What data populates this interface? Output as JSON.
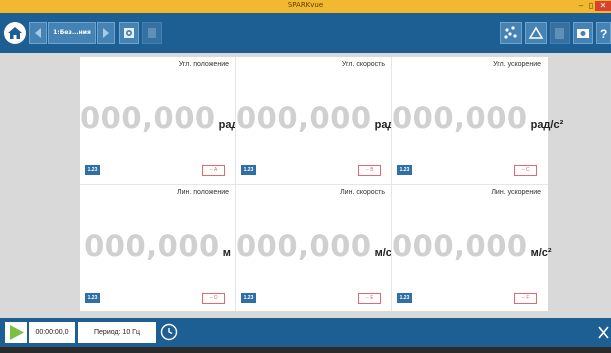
{
  "window": {
    "title": "SPARKvue",
    "minimize_label": "–",
    "restore_label": "▯",
    "close_label": "✕"
  },
  "toolbar": {
    "breadcrumb": "1:Без...ния"
  },
  "meters": [
    {
      "label": "Угл. положение",
      "value": "000,000",
      "unit": "рад",
      "format_label": "1.23",
      "sensor_label": "-- A"
    },
    {
      "label": "Угл. скорость",
      "value": "000,000",
      "unit": "рад/с",
      "format_label": "1.23",
      "sensor_label": "-- B"
    },
    {
      "label": "Угл. ускорение",
      "value": "000,000",
      "unit": "рад/с²",
      "format_label": "1.23",
      "sensor_label": "-- C"
    },
    {
      "label": "Лин. положение",
      "value": "000,000",
      "unit": "м",
      "format_label": "1.23",
      "sensor_label": "-- D"
    },
    {
      "label": "Лин. скорость",
      "value": "000,000",
      "unit": "м/с",
      "format_label": "1.23",
      "sensor_label": "-- E"
    },
    {
      "label": "Лин. ускорение",
      "value": "000,000",
      "unit": "м/с²",
      "format_label": "1.23",
      "sensor_label": "-- F"
    }
  ],
  "controls": {
    "timer": "00:00:00,0",
    "period": "Период: 10 Гц"
  },
  "colors": {
    "toolbar": "#1d5f92",
    "titlebar": "#f2b830",
    "accent_green": "#7ac143",
    "placeholder_value": "#d0d0d0",
    "sensor_outline": "#e46a6a"
  }
}
